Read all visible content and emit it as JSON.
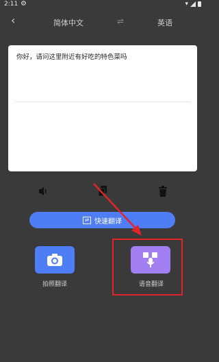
{
  "status_bar": {
    "time": "2:11",
    "gear": "⚙"
  },
  "topbar": {
    "back": "‹",
    "source_language": "简体中文",
    "swap": "⇌",
    "target_language": "英语"
  },
  "input": {
    "text": "你好，请问这里附近有好吃的特色菜吗"
  },
  "actions": {
    "quick_translate": "快速翻译"
  },
  "tools": {
    "photo_label": "拍照翻译",
    "voice_label": "语音翻译"
  },
  "colors": {
    "accent_blue": "#4f7df5",
    "voice_purple": "#a17ff2",
    "annotation_red": "#e0242a"
  },
  "icons": [
    "back-icon",
    "swap-icon",
    "speaker-icon",
    "copy-icon",
    "trash-icon",
    "camera-icon",
    "voice-translate-icon"
  ]
}
